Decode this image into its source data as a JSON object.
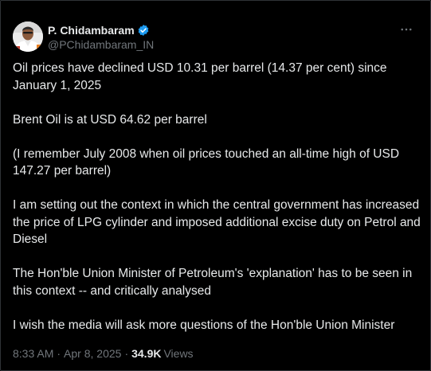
{
  "author": {
    "display_name": "P. Chidambaram",
    "handle": "@PChidambaram_IN",
    "verified": true,
    "verified_color": "#1d9bf0",
    "avatar_icon": "profile-photo"
  },
  "tweet": {
    "paragraphs": [
      "Oil prices have declined USD 10.31 per barrel (14.37 per cent) since January 1, 2025",
      "Brent Oil is at USD 64.62 per barrel",
      "(I remember July 2008 when oil prices touched an all-time high of USD 147.27 per barrel)",
      "I am setting out the context in which the central government has increased the price of LPG cylinder and imposed additional excise duty on Petrol and Diesel",
      "The Hon'ble Union Minister of Petroleum's 'explanation' has to be seen in this context -- and critically analysed",
      "I wish the media will ask more questions of the Hon'ble Union Minister"
    ]
  },
  "meta": {
    "time": "8:33 AM",
    "separator": "·",
    "date": "Apr 8, 2025",
    "views_count": "34.9K",
    "views_label": "Views"
  },
  "colors": {
    "background": "#000000",
    "text_primary": "#e7e9ea",
    "text_secondary": "#71767b",
    "border": "#2f3336"
  }
}
